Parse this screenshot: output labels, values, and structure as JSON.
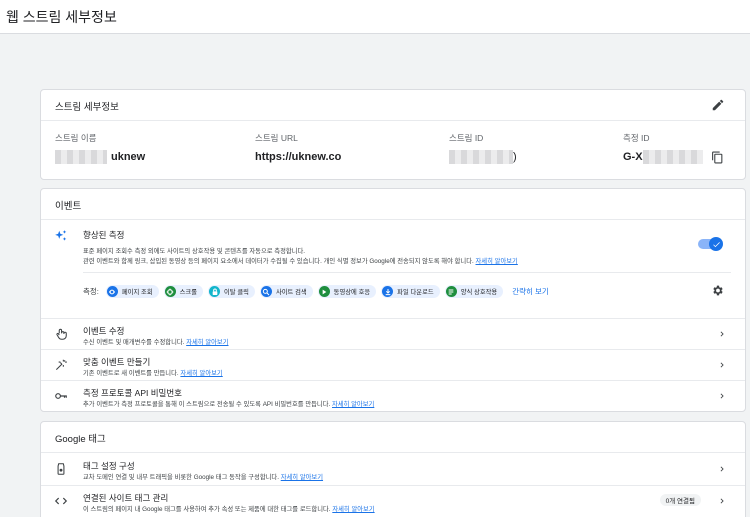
{
  "page": {
    "title": "웹 스트림 세부정보"
  },
  "stream_details": {
    "title": "스트림 세부정보",
    "name_label": "스트림 이름",
    "name_value": "uknew",
    "url_label": "스트림 URL",
    "url_value": "https://uknew.co",
    "id_label": "스트림 ID",
    "id_suffix": ")",
    "measurement_label": "측정 ID",
    "measurement_prefix": "G-X"
  },
  "events": {
    "title": "이벤트",
    "enhanced": {
      "title": "향상된 측정",
      "desc_line1": "표준 페이지 조회수 측정 외에도 사이트의 상호작용 및 콘텐츠를 자동으로 측정합니다.",
      "desc_line2": "관련 이벤트와 함께 링크, 삽입된 동영상 등의 페이지 요소에서 데이터가 수집될 수 있습니다. 개인 식별 정보가 Google에 전송되지 않도록 해야 합니다.",
      "desc_link": "자세히 알아보기",
      "toggle_on": true,
      "measuring_label": "측정:",
      "chips": [
        {
          "label": "페이지 조회",
          "icon": "eye-icon",
          "color": "#1a73e8"
        },
        {
          "label": "스크롤",
          "icon": "crosshair-icon",
          "color": "#1e8e3e"
        },
        {
          "label": "이탈 클릭",
          "icon": "lock-icon",
          "color": "#12b5cb"
        },
        {
          "label": "사이트 검색",
          "icon": "search-icon",
          "color": "#1a73e8"
        },
        {
          "label": "동영상에 호응",
          "icon": "play-icon",
          "color": "#1e8e3e"
        },
        {
          "label": "파일 다운로드",
          "icon": "download-icon",
          "color": "#1a73e8"
        },
        {
          "label": "양식 상호작용",
          "icon": "form-icon",
          "color": "#1e8e3e"
        }
      ],
      "show_less": "간략히 보기"
    },
    "rows": [
      {
        "title": "이벤트 수정",
        "desc": "수신 이벤트 및 매개변수를 수정합니다.",
        "link": "자세히 알아보기"
      },
      {
        "title": "맞춤 이벤트 만들기",
        "desc": "기존 이벤트로 새 이벤트를 만듭니다.",
        "link": "자세히 알아보기"
      },
      {
        "title": "측정 프로토콜 API 비밀번호",
        "desc": "추가 이벤트가 측정 프로토콜을 통해 이 스트림으로 전송될 수 있도록 API 비밀번호를 만듭니다.",
        "link": "자세히 알아보기"
      }
    ]
  },
  "google_tag": {
    "title": "Google 태그",
    "rows": [
      {
        "title": "태그 설정 구성",
        "desc": "교차 도메인 연결 및 내부 트래픽을 비롯한 Google 태그 동작을 구성합니다.",
        "link": "자세히 알아보기"
      },
      {
        "title": "연결된 사이트 태그 관리",
        "desc": "이 스트림의 페이지 내 Google 태그를 사용하여 추가 속성 또는 제품에 대한 태그를 로드합니다.",
        "link": "자세히 알아보기",
        "badge": "0개 연결됨"
      }
    ]
  }
}
